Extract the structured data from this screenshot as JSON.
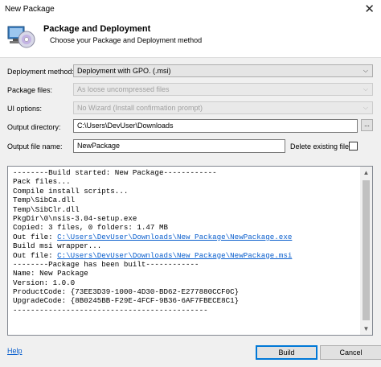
{
  "window": {
    "title": "New Package",
    "close_glyph": "✕"
  },
  "header": {
    "title": "Package and Deployment",
    "subtitle": "Choose your Package and Deployment method",
    "icon": "installer-cd-icon"
  },
  "form": {
    "deployment_method": {
      "label": "Deployment method:",
      "value": "Deployment with GPO. (.msi)"
    },
    "package_files": {
      "label": "Package files:",
      "value": "As loose uncompressed files"
    },
    "ui_options": {
      "label": "UI options:",
      "value": "No Wizard (Install confirmation prompt)"
    },
    "output_directory": {
      "label": "Output directory:",
      "value": "C:\\Users\\DevUser\\Downloads",
      "browse_label": "..."
    },
    "output_file_name": {
      "label": "Output file name:",
      "value": "NewPackage"
    },
    "delete_existing": {
      "label": "Delete existing files",
      "checked": false
    }
  },
  "log": {
    "lines": [
      "--------Build started: New Package------------",
      "Pack files...",
      "Compile install scripts...",
      "Temp\\SibCa.dll",
      "Temp\\SibClr.dll",
      "PkgDir\\0\\nsis-3.04-setup.exe",
      "Copied: 3 files, 0 folders: 1.47 MB",
      "Build msi wrapper...",
      "--------Package has been built------------",
      "Name: New Package",
      "Version: 1.0.0",
      "ProductCode: {73EE3D39-1000-4D30-BD62-E277880CCF0C}",
      "UpgradeCode: {8B0245BB-F29E-4FCF-9B36-6AF7FBECE8C1}",
      "--------------------------------------------"
    ],
    "out_file_label": "Out file: ",
    "out_file_exe": "C:\\Users\\DevUser\\Downloads\\New Package\\NewPackage.exe",
    "out_file_msi": "C:\\Users\\DevUser\\Downloads\\New Package\\NewPackage.msi"
  },
  "footer": {
    "help_label": "Help",
    "build_label": "Build",
    "cancel_label": "Cancel"
  },
  "colors": {
    "link": "#0b5fcd",
    "accent": "#0078d7"
  }
}
